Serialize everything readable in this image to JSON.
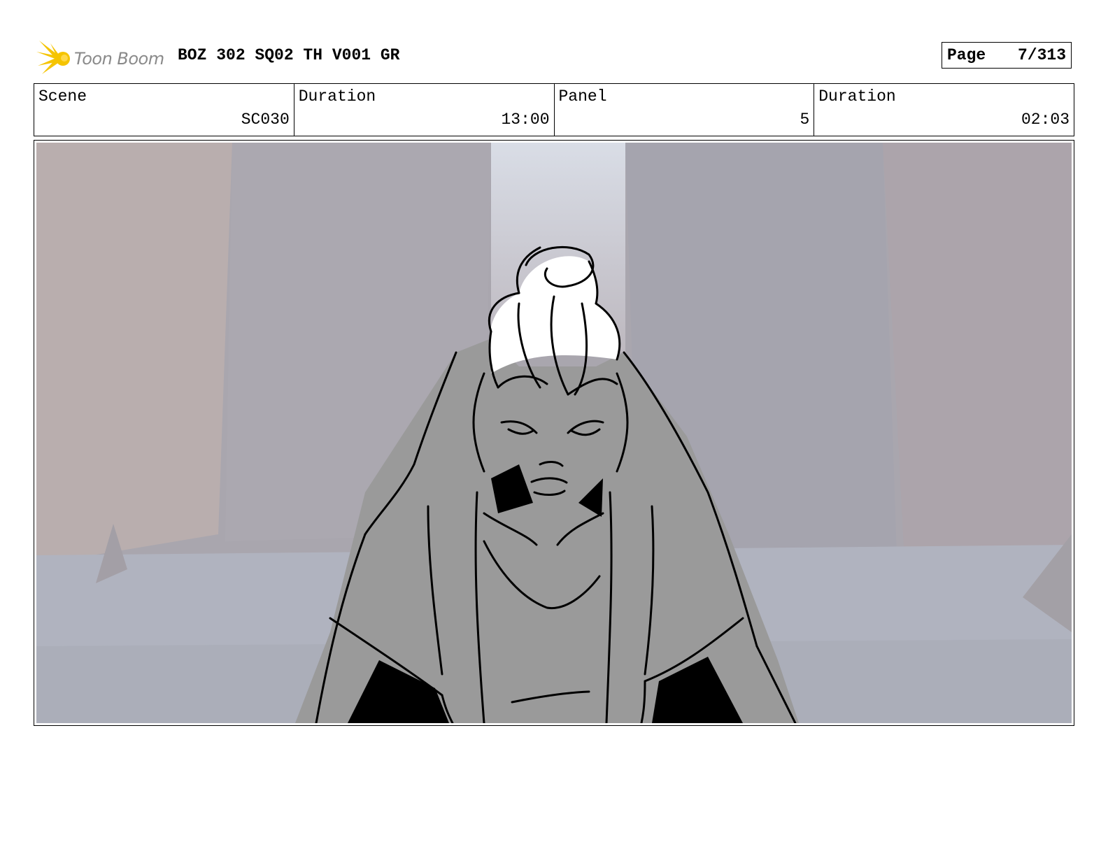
{
  "header": {
    "logo_text": "Toon Boom",
    "title": "BOZ 302 SQ02 TH V001 GR",
    "page_label": "Page",
    "page_value": "7/313"
  },
  "info": {
    "scene_label": "Scene",
    "scene_value": "SC030",
    "duration_label": "Duration",
    "duration_value": "13:00",
    "panel_label": "Panel",
    "panel_value": "5",
    "panel_duration_label": "Duration",
    "panel_duration_value": "02:03"
  },
  "colors": {
    "logo_flame": "#f5c400",
    "logo_text": "#8a8a8a",
    "background_wall": "#a9a6ae",
    "character_fill": "#9a9a9a"
  },
  "icons": [
    "toon-boom-logo-icon"
  ]
}
